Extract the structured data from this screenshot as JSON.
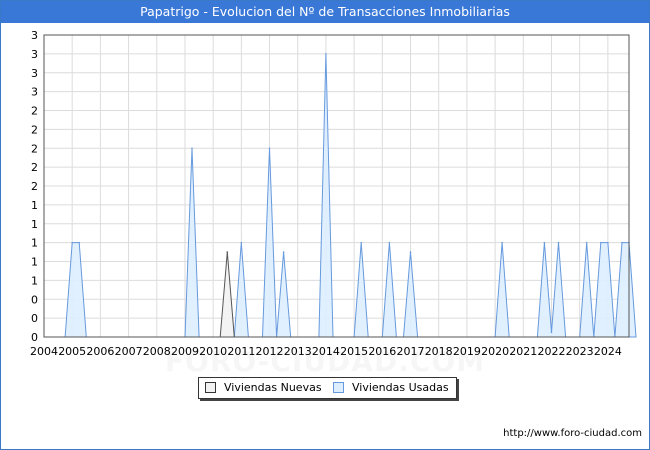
{
  "title": "Papatrigo - Evolucion del Nº de Transacciones Inmobiliarias",
  "source": "http://www.foro-ciudad.com",
  "watermark": "FORO-CIUDAD.COM",
  "colors": {
    "title_bar": "#3a78d8",
    "nuevas_fill": "#f2f2f2",
    "nuevas_line": "#555555",
    "usadas_fill": "#ddeeff",
    "usadas_line": "#6699dd"
  },
  "chart_data": {
    "type": "area",
    "title": "Papatrigo - Evolucion del Nº de Transacciones Inmobiliarias",
    "x_tick_labels": [
      "2004",
      "2005",
      "2006",
      "2007",
      "2008",
      "2009",
      "2010",
      "2011",
      "2012",
      "2013",
      "2014",
      "2015",
      "2016",
      "2017",
      "2018",
      "2019",
      "2020",
      "2021",
      "2022",
      "2023",
      "2024"
    ],
    "y_tick_labels": [
      "0",
      "0",
      "0",
      "1",
      "1",
      "1",
      "1",
      "1",
      "2",
      "2",
      "2",
      "2",
      "2",
      "3",
      "3",
      "3",
      "3"
    ],
    "ylim": [
      0,
      3.2
    ],
    "xlim": [
      2004,
      2024.75
    ],
    "grid": true,
    "legend_position": "bottom",
    "series": [
      {
        "name": "Viviendas Nuevas",
        "peaks": [
          {
            "x": 2010.0,
            "y": 0
          },
          {
            "x": 2010.25,
            "y": 0
          },
          {
            "x": 2010.5,
            "y": 0.9
          },
          {
            "x": 2010.75,
            "y": 0
          }
        ]
      },
      {
        "name": "Viviendas Usadas",
        "peaks": [
          {
            "x": 2004.75,
            "y": 0
          },
          {
            "x": 2005.0,
            "y": 1
          },
          {
            "x": 2005.25,
            "y": 1
          },
          {
            "x": 2005.5,
            "y": 0
          },
          {
            "x": 2009.0,
            "y": 0
          },
          {
            "x": 2009.25,
            "y": 2
          },
          {
            "x": 2009.5,
            "y": 0
          },
          {
            "x": 2010.75,
            "y": 0
          },
          {
            "x": 2011.0,
            "y": 1
          },
          {
            "x": 2011.25,
            "y": 0
          },
          {
            "x": 2011.75,
            "y": 0
          },
          {
            "x": 2012.0,
            "y": 2
          },
          {
            "x": 2012.25,
            "y": 0
          },
          {
            "x": 2012.25,
            "y": 0
          },
          {
            "x": 2012.5,
            "y": 0.9
          },
          {
            "x": 2012.75,
            "y": 0
          },
          {
            "x": 2013.75,
            "y": 0
          },
          {
            "x": 2014.0,
            "y": 3
          },
          {
            "x": 2014.25,
            "y": 0
          },
          {
            "x": 2015.0,
            "y": 0
          },
          {
            "x": 2015.25,
            "y": 1
          },
          {
            "x": 2015.5,
            "y": 0
          },
          {
            "x": 2016.0,
            "y": 0
          },
          {
            "x": 2016.25,
            "y": 1
          },
          {
            "x": 2016.5,
            "y": 0
          },
          {
            "x": 2016.75,
            "y": 0
          },
          {
            "x": 2017.0,
            "y": 0.9
          },
          {
            "x": 2017.25,
            "y": 0
          },
          {
            "x": 2020.0,
            "y": 0
          },
          {
            "x": 2020.25,
            "y": 1
          },
          {
            "x": 2020.5,
            "y": 0
          },
          {
            "x": 2021.5,
            "y": 0
          },
          {
            "x": 2021.75,
            "y": 1
          },
          {
            "x": 2022.0,
            "y": 0.05
          },
          {
            "x": 2022.25,
            "y": 1
          },
          {
            "x": 2022.5,
            "y": 0
          },
          {
            "x": 2023.0,
            "y": 0
          },
          {
            "x": 2023.25,
            "y": 1
          },
          {
            "x": 2023.5,
            "y": 0
          },
          {
            "x": 2023.5,
            "y": 0
          },
          {
            "x": 2023.75,
            "y": 1
          },
          {
            "x": 2024.0,
            "y": 1
          },
          {
            "x": 2024.25,
            "y": 0
          },
          {
            "x": 2024.25,
            "y": 0
          },
          {
            "x": 2024.5,
            "y": 1
          },
          {
            "x": 2024.75,
            "y": 1
          },
          {
            "x": 2025.0,
            "y": 0
          }
        ]
      }
    ]
  }
}
